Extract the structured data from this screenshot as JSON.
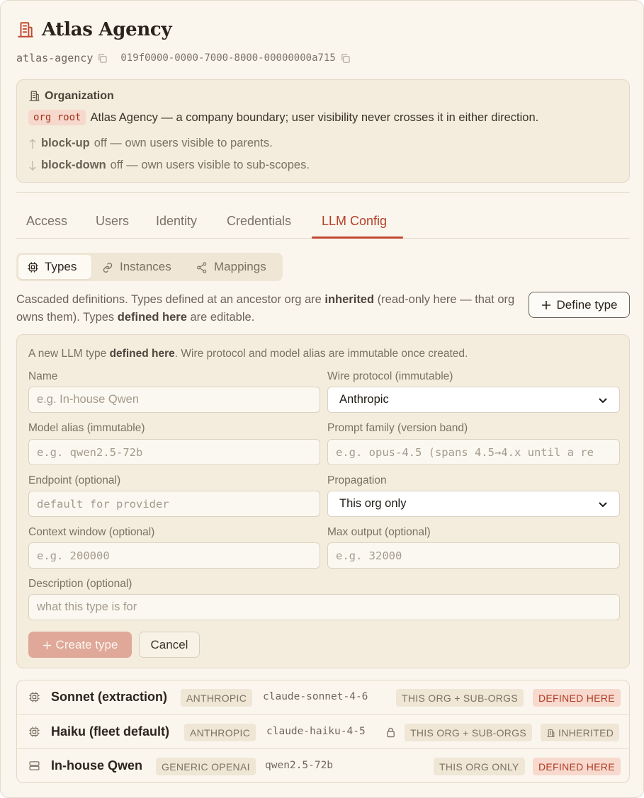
{
  "header": {
    "title": "Atlas Agency",
    "slug": "atlas-agency",
    "uuid": "019f0000-0000-7000-8000-00000000a715"
  },
  "org": {
    "heading": "Organization",
    "badge": "org root",
    "description": "Atlas Agency — a company boundary; user visibility never crosses it in either direction.",
    "block_up_label": "block-up",
    "block_up_text": "off — own users visible to parents.",
    "block_down_label": "block-down",
    "block_down_text": "off — own users visible to sub-scopes."
  },
  "tabs": [
    {
      "label": "Access"
    },
    {
      "label": "Users"
    },
    {
      "label": "Identity"
    },
    {
      "label": "Credentials"
    },
    {
      "label": "LLM Config"
    }
  ],
  "subtabs": [
    {
      "label": "Types"
    },
    {
      "label": "Instances"
    },
    {
      "label": "Mappings"
    }
  ],
  "cascade": {
    "t1": "Cascaded definitions. Types defined at an ancestor org are ",
    "b1": "inherited",
    "t2": " (read-only here — that org owns them). Types ",
    "b2": "defined here",
    "t3": " are editable."
  },
  "define_button": "Define type",
  "form": {
    "intro_a": "A new LLM type ",
    "intro_b": "defined here",
    "intro_c": ". Wire protocol and model alias are immutable once created.",
    "name_label": "Name",
    "name_placeholder": "e.g. In-house Qwen",
    "wire_label": "Wire protocol (immutable)",
    "wire_value": "Anthropic",
    "alias_label": "Model alias (immutable)",
    "alias_placeholder": "e.g. qwen2.5-72b",
    "family_label": "Prompt family (version band)",
    "family_placeholder": "e.g. opus-4.5 (spans 4.5→4.x until a re",
    "endpoint_label": "Endpoint (optional)",
    "endpoint_placeholder": "default for provider",
    "propagation_label": "Propagation",
    "propagation_value": "This org only",
    "context_label": "Context window (optional)",
    "context_placeholder": "e.g. 200000",
    "maxout_label": "Max output (optional)",
    "maxout_placeholder": "e.g. 32000",
    "desc_label": "Description (optional)",
    "desc_placeholder": "what this type is for",
    "create_label": "Create type",
    "cancel_label": "Cancel"
  },
  "types": [
    {
      "name": "Sonnet (extraction)",
      "protocol": "ANTHROPIC",
      "model": "claude-sonnet-4-6",
      "scope": "THIS ORG + SUB-ORGS",
      "status": "DEFINED HERE"
    },
    {
      "name": "Haiku (fleet default)",
      "protocol": "ANTHROPIC",
      "model": "claude-haiku-4-5",
      "scope": "THIS ORG + SUB-ORGS",
      "status": "INHERITED"
    },
    {
      "name": "In-house Qwen",
      "protocol": "GENERIC OPENAI",
      "model": "qwen2.5-72b",
      "scope": "THIS ORG ONLY",
      "status": "DEFINED HERE"
    }
  ],
  "colors": {
    "accent": "#c1492f",
    "panel_bg": "#faf6ee",
    "box_bg": "#f4ecdd"
  }
}
